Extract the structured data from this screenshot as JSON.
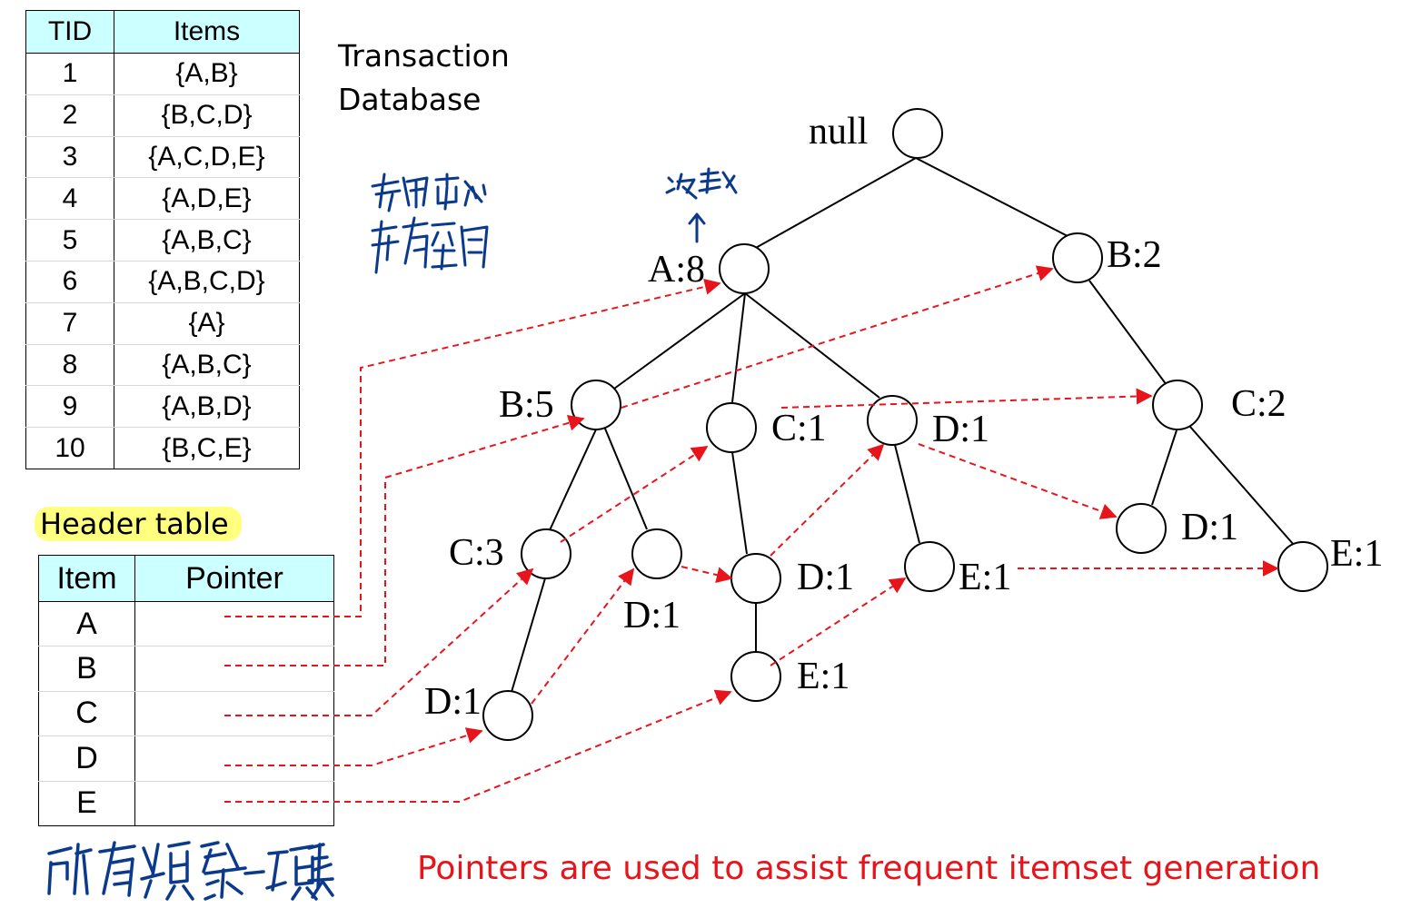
{
  "transaction_table": {
    "headers": [
      "TID",
      "Items"
    ],
    "rows": [
      [
        "1",
        "{A,B}"
      ],
      [
        "2",
        "{B,C,D}"
      ],
      [
        "3",
        "{A,C,D,E}"
      ],
      [
        "4",
        "{A,D,E}"
      ],
      [
        "5",
        "{A,B,C}"
      ],
      [
        "6",
        "{A,B,C,D}"
      ],
      [
        "7",
        "{A}"
      ],
      [
        "8",
        "{A,B,C}"
      ],
      [
        "9",
        "{A,B,D}"
      ],
      [
        "10",
        "{B,C,E}"
      ]
    ]
  },
  "database_label": [
    "Transaction",
    "Database"
  ],
  "header_table_label": "Header table",
  "header_table": {
    "headers": [
      "Item",
      "Pointer"
    ],
    "rows": [
      "A",
      "B",
      "C",
      "D",
      "E"
    ]
  },
  "tree": {
    "root_label": "null",
    "nodes": [
      "A:8",
      "B:2",
      "B:5",
      "C:1",
      "D:1",
      "C:2",
      "C:3",
      "D:1",
      "D:1",
      "D:1",
      "E:1",
      "E:1",
      "E:1",
      "D:1"
    ]
  },
  "handwritten_notes": [
    "先用节点",
    "节省空间",
    "次数",
    "所有频繁一项集"
  ],
  "caption": "Pointers are used to assist frequent itemset generation",
  "colors": {
    "pointer_line": "#e8141b",
    "header_fill": "#ccffff",
    "highlight": "#ffff80",
    "ink": "#0b3a8c"
  }
}
